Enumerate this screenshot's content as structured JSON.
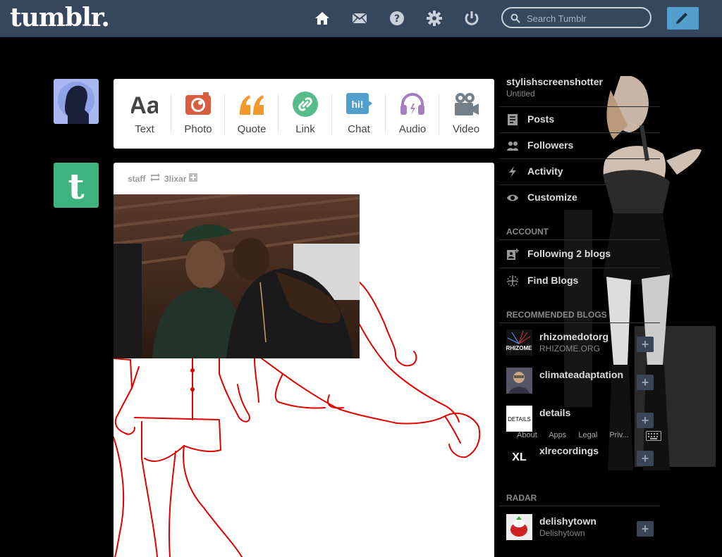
{
  "header": {
    "logo": "tumblr.",
    "search_placeholder": "Search Tumblr"
  },
  "post_types": [
    {
      "label": "Text",
      "icon": "text-icon",
      "color": "#444444"
    },
    {
      "label": "Photo",
      "icon": "camera-icon",
      "color": "#d95e40"
    },
    {
      "label": "Quote",
      "icon": "quote-icon",
      "color": "#f2992e"
    },
    {
      "label": "Link",
      "icon": "link-icon",
      "color": "#56bc8a"
    },
    {
      "label": "Chat",
      "icon": "chat-icon",
      "color": "#529ecc"
    },
    {
      "label": "Audio",
      "icon": "headphones-icon",
      "color": "#a77dc2"
    },
    {
      "label": "Video",
      "icon": "video-icon",
      "color": "#748089"
    }
  ],
  "post": {
    "author": "staff",
    "reblogged_from": "3lixar"
  },
  "sidebar": {
    "blog_name": "stylishscreenshotter",
    "blog_title": "Untitled",
    "items": [
      {
        "label": "Posts",
        "icon": "posts-icon"
      },
      {
        "label": "Followers",
        "icon": "followers-icon"
      },
      {
        "label": "Activity",
        "icon": "activity-icon"
      },
      {
        "label": "Customize",
        "icon": "eye-icon"
      }
    ],
    "account_heading": "ACCOUNT",
    "account_items": [
      {
        "label": "Following 2 blogs",
        "icon": "following-icon"
      },
      {
        "label": "Find Blogs",
        "icon": "compass-icon"
      }
    ],
    "recommended_heading": "RECOMMENDED BLOGS",
    "recommended": [
      {
        "name": "rhizomedotorg",
        "sub": "RHIZOME.ORG",
        "thumb_text": "RHIZOME"
      },
      {
        "name": "climateadaptation",
        "sub": "",
        "thumb_text": ""
      },
      {
        "name": "details",
        "sub": "",
        "thumb_text": "DETAILS"
      },
      {
        "name": "xlrecordings",
        "sub": "",
        "thumb_text": "XL"
      }
    ],
    "radar_heading": "RADAR",
    "radar": {
      "name": "delishytown",
      "sub": "Delishytown"
    },
    "footer": [
      "About",
      "Apps",
      "Legal",
      "Priv..."
    ]
  },
  "colors": {
    "topbar": "#36465d",
    "compose": "#529ecc",
    "dashboard_bg": "#000000",
    "doodle": "#e00000",
    "avatar_tumblr": "#3fb37f"
  }
}
